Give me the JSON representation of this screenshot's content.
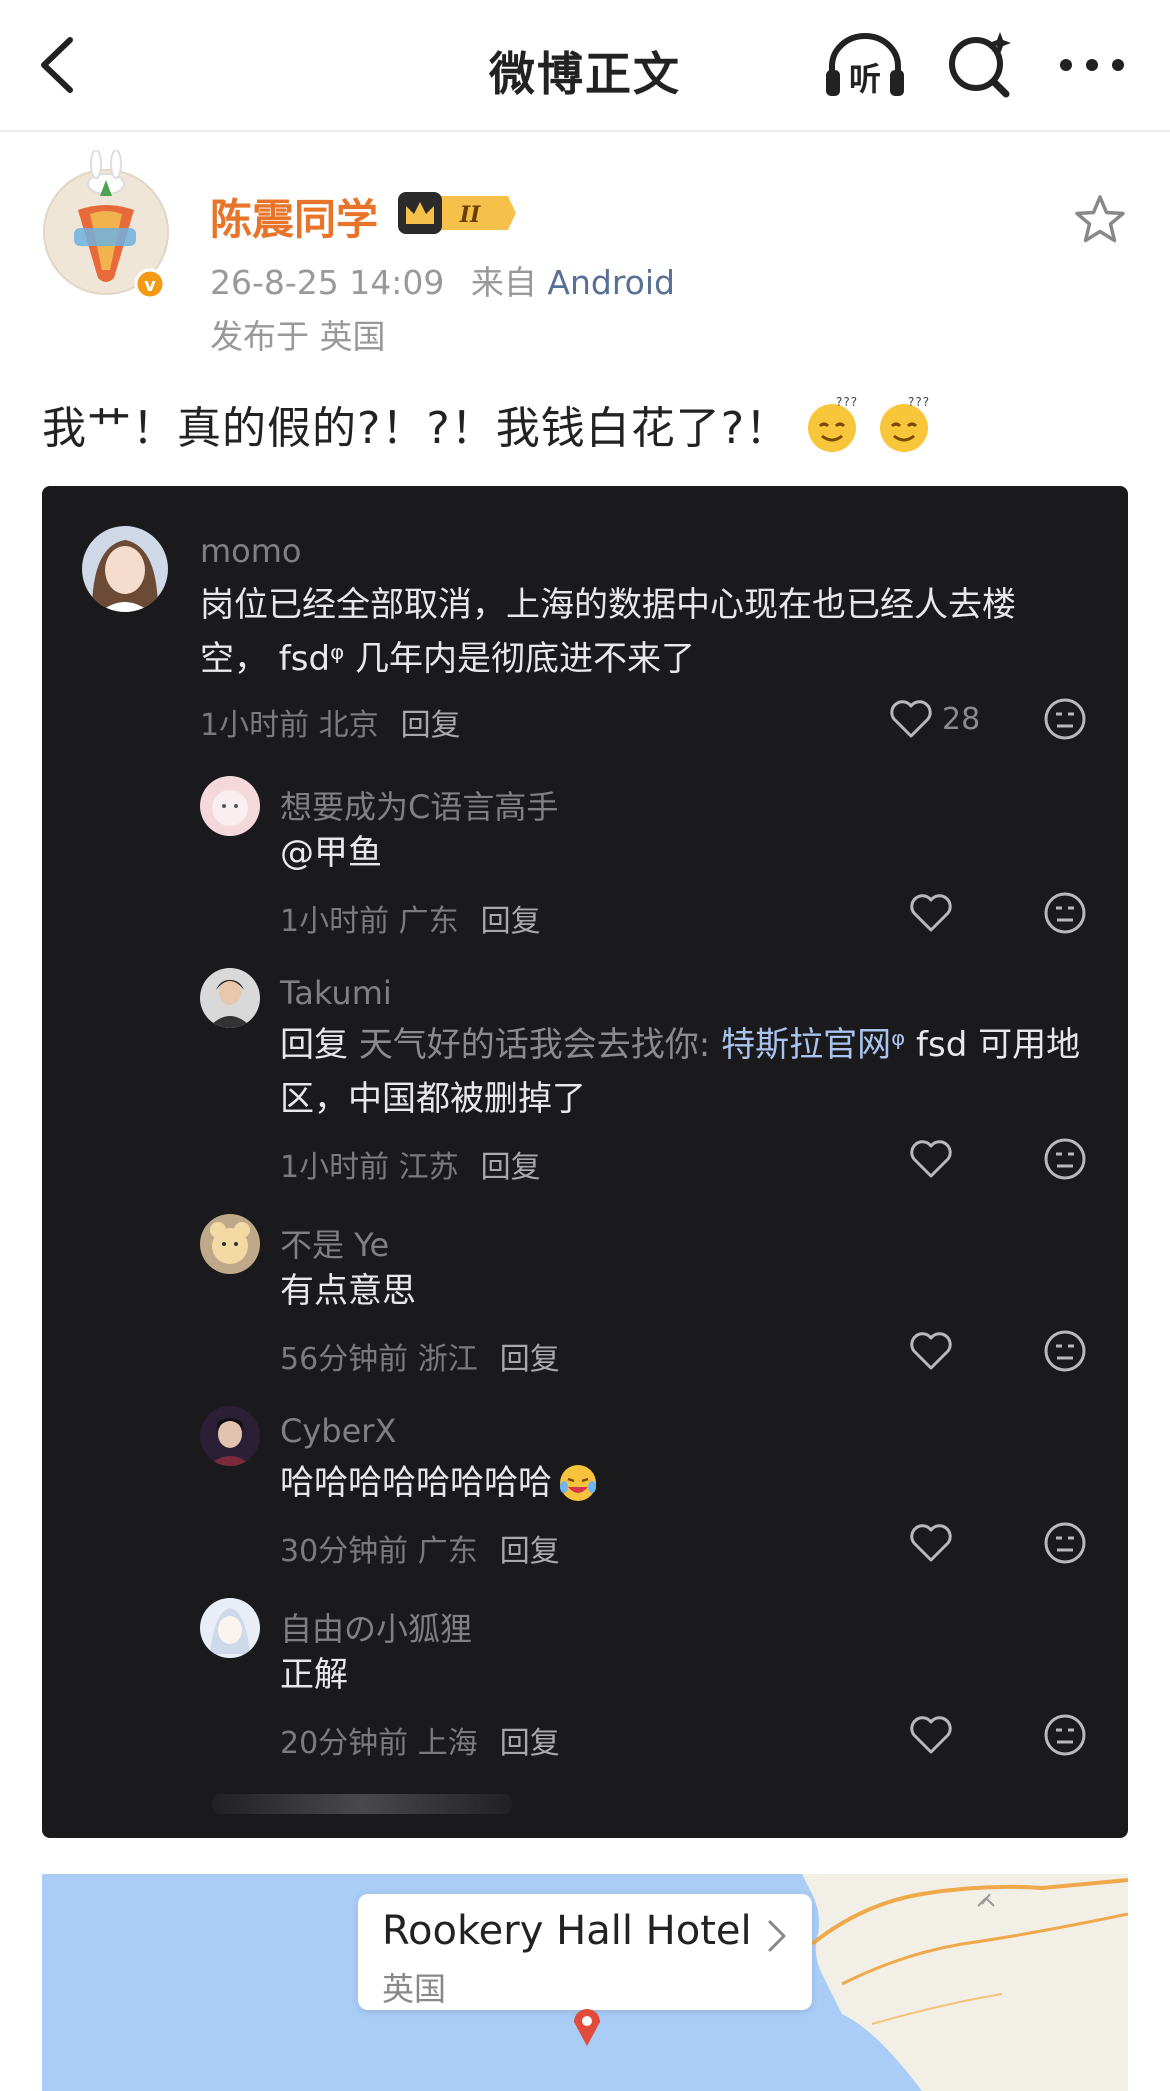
{
  "header": {
    "title": "微博正文",
    "listen_label": "听"
  },
  "post": {
    "author": "陈震同学",
    "vip_level": "II",
    "timestamp": "26-8-25 14:09",
    "source_prefix": "来自",
    "source": "Android",
    "location": "发布于 英国",
    "text": "我艹！真的假的?！?！我钱白花了?！"
  },
  "comments": [
    {
      "user": "momo",
      "text_lines": [
        "岗位已经全部取消，上海的数据中心现在也已经人去楼",
        "空， fsdᵠ 几年内是彻底进不来了"
      ],
      "time": "1小时前 北京",
      "reply": "回复",
      "likes": "28"
    },
    {
      "user": "想要成为C语言高手",
      "text": "@甲鱼",
      "time": "1小时前 广东",
      "reply": "回复"
    },
    {
      "user": "Takumi",
      "reply_prefix": "回复",
      "reply_to": "天气好的话我会去找你:",
      "link": "特斯拉官网ᵠ",
      "text_rest": " fsd 可用地",
      "text_line2": "区，中国都被删掉了",
      "time": "1小时前 江苏",
      "reply": "回复"
    },
    {
      "user": "不是 Ye",
      "text": "有点意思",
      "time": "56分钟前 浙江",
      "reply": "回复"
    },
    {
      "user": "CyberX",
      "text": "哈哈哈哈哈哈哈哈",
      "time": "30分钟前 广东",
      "reply": "回复"
    },
    {
      "user": "自由の小狐狸",
      "text": "正解",
      "time": "20分钟前 上海",
      "reply": "回复"
    }
  ],
  "map": {
    "place_name": "Rookery Hall Hotel",
    "country": "英国"
  },
  "colors": {
    "accent_orange": "#e8742a",
    "link_blue": "#5a6f98",
    "card_bg": "#1a1a1c",
    "map_water": "#a9cdf7"
  }
}
